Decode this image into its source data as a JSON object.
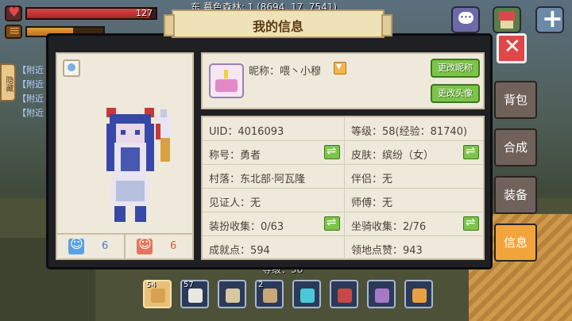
{
  "hud": {
    "hp_value": "127",
    "hp_fraction": 0.95,
    "hunger_fraction": 0.6,
    "location": "东 墓色森林: 1 (8694, 17, 7541)"
  },
  "chat": {
    "nearby_lines": [
      "【附近",
      "【附近",
      "【附近",
      "【附近"
    ],
    "side_tab": "隐藏"
  },
  "dialog": {
    "title": "我的信息"
  },
  "avatar_panel": {
    "like_count": "6",
    "dislike_count": "6"
  },
  "profile": {
    "nickname_text": "昵称：喂丶小穆",
    "change_nickname_label": "更改昵称",
    "change_avatar_label": "更改头像"
  },
  "info": {
    "uid": "UID：4016093",
    "level": "等级：58(经验：81740)",
    "title": "称号：勇者",
    "skin": "皮肤：缤纷（女）",
    "village": "村落：东北部·阿瓦隆",
    "partner": "伴侣：无",
    "witness": "见证人：无",
    "master": "师傅：无",
    "outfit_collection": "装扮收集：0/63",
    "mount_collection": "坐骑收集：2/76",
    "achievement": "成就点：594",
    "territory_likes": "领地点赞：943"
  },
  "right_tabs": [
    {
      "label": "背包",
      "active": false
    },
    {
      "label": "合成",
      "active": false
    },
    {
      "label": "装备",
      "active": false
    },
    {
      "label": "信息",
      "active": true
    }
  ],
  "background_level_text": "等级：58",
  "hotbar": [
    {
      "count": "54",
      "icon": "bread-icon",
      "color": "#d8a050",
      "selected": true
    },
    {
      "count": "57",
      "icon": "bottle-icon",
      "color": "#e8e8e0",
      "selected": false
    },
    {
      "count": "",
      "icon": "scroll-icon",
      "color": "#d8c8a0",
      "selected": false
    },
    {
      "count": "2",
      "icon": "bowl-icon",
      "color": "#c8a878",
      "selected": false
    },
    {
      "count": "",
      "icon": "pickaxe-icon",
      "color": "#4ac8d8",
      "selected": false
    },
    {
      "count": "",
      "icon": "sword-icon",
      "color": "#c84848",
      "selected": false
    },
    {
      "count": "",
      "icon": "bow-icon",
      "color": "#a878c8",
      "selected": false
    },
    {
      "count": "",
      "icon": "drink-icon",
      "color": "#e8a040",
      "selected": false
    }
  ]
}
